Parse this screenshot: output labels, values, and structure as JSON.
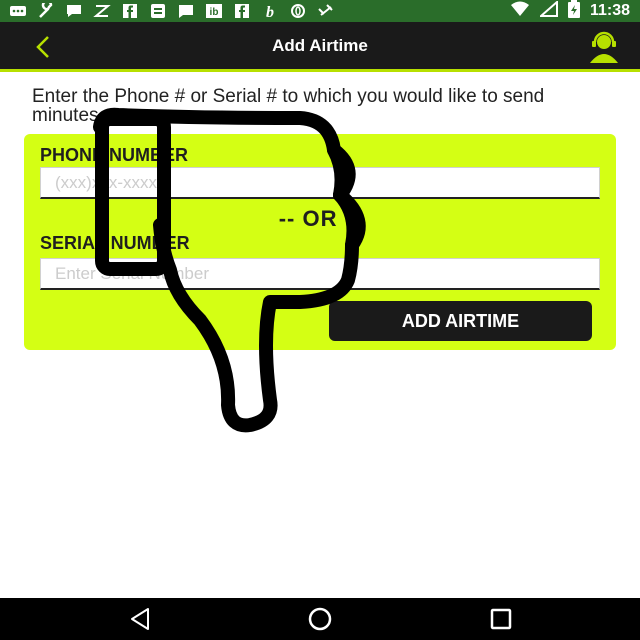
{
  "status_bar": {
    "time": "11:38",
    "left_icons": [
      "chat-icon",
      "wrench-icon",
      "bbm-icon",
      "zello-icon",
      "facebook-icon",
      "drive-icon",
      "messages-icon",
      "ib-icon",
      "facebook-icon",
      "b-icon",
      "opera-icon",
      "satellite-icon"
    ],
    "right_icons": [
      "wifi-icon",
      "signal-icon",
      "battery-icon"
    ]
  },
  "header": {
    "title": "Add Airtime",
    "back_icon": "chevron-left-icon",
    "support_icon": "support-agent-icon"
  },
  "instructions": "Enter the Phone # or Serial # to which you would like to send minutes.",
  "form": {
    "phone_label": "PHONE NUMBER",
    "phone_placeholder": "(xxx)xxx-xxxx",
    "or_text": "-- OR --",
    "serial_label": "SERIAL NUMBER",
    "serial_placeholder": "Enter Serial Number",
    "submit_label": "ADD AIRTIME"
  },
  "colors": {
    "accent": "#d4ff14",
    "header_bg": "#1a1a1a",
    "status_bg": "#2a6d2a"
  },
  "nav": {
    "items": [
      "nav-back-icon",
      "nav-home-icon",
      "nav-recents-icon"
    ]
  }
}
